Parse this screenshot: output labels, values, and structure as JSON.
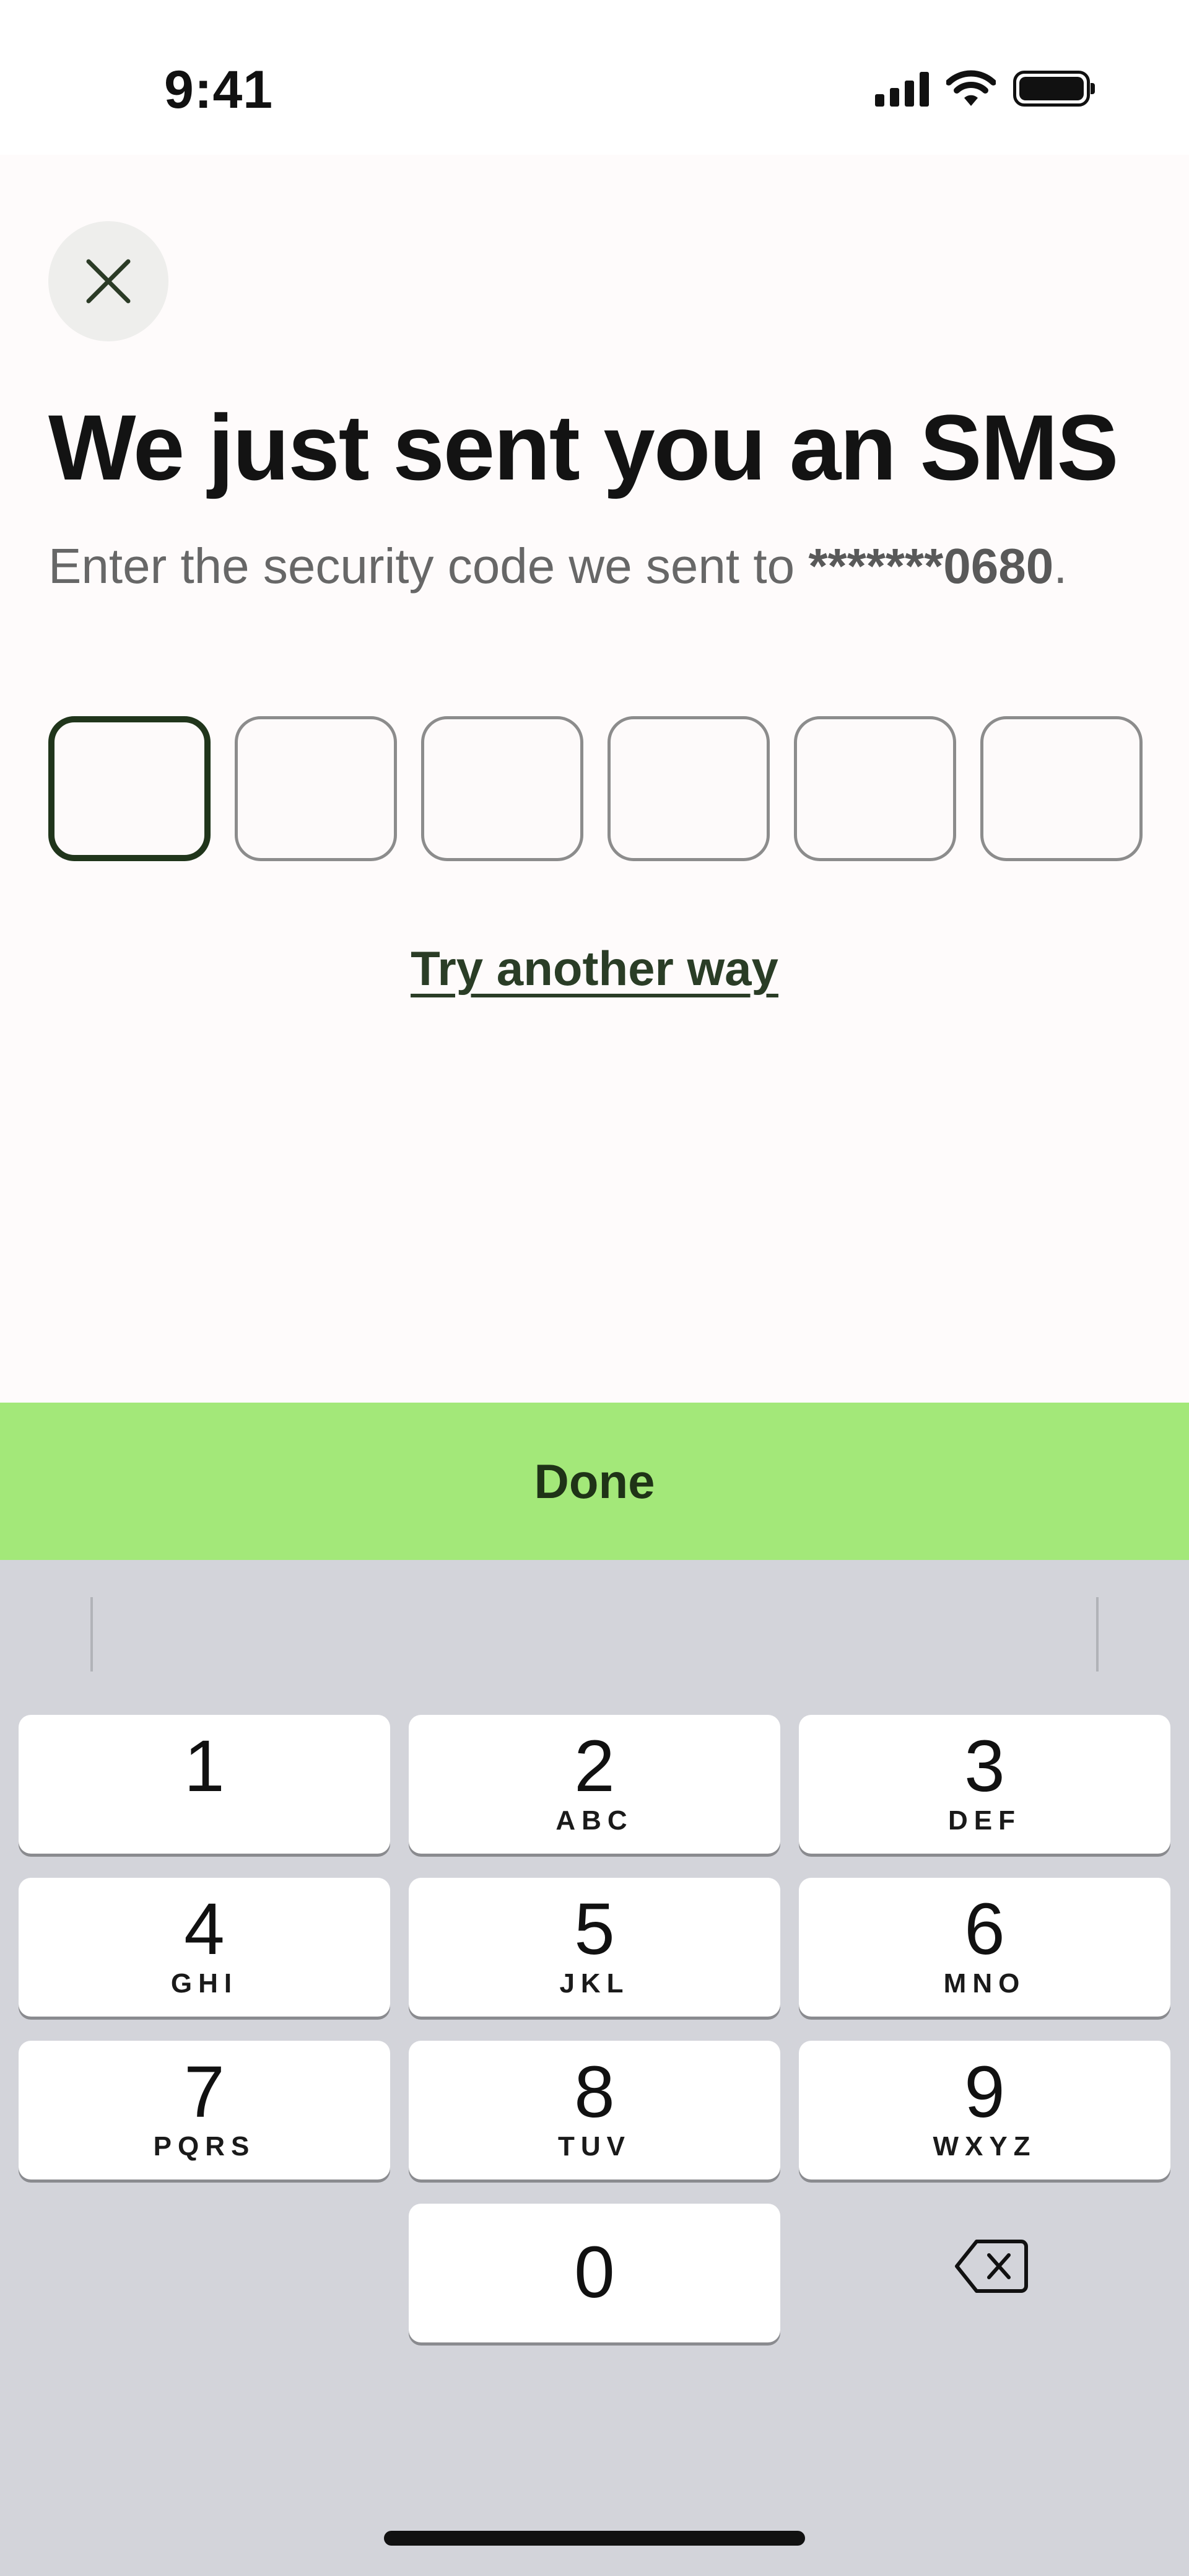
{
  "status": {
    "time": "9:41"
  },
  "header": {
    "title": "We just sent you an SMS",
    "subtitle_prefix": "Enter the security code we sent to ",
    "masked_number": "*******0680",
    "subtitle_suffix": "."
  },
  "code": {
    "length": 6,
    "values": [
      "",
      "",
      "",
      "",
      "",
      ""
    ],
    "active_index": 0
  },
  "links": {
    "try_another": "Try another way"
  },
  "actions": {
    "done_label": "Done"
  },
  "keypad": {
    "keys": [
      {
        "digit": "1",
        "letters": ""
      },
      {
        "digit": "2",
        "letters": "ABC"
      },
      {
        "digit": "3",
        "letters": "DEF"
      },
      {
        "digit": "4",
        "letters": "GHI"
      },
      {
        "digit": "5",
        "letters": "JKL"
      },
      {
        "digit": "6",
        "letters": "MNO"
      },
      {
        "digit": "7",
        "letters": "PQRS"
      },
      {
        "digit": "8",
        "letters": "TUV"
      },
      {
        "digit": "9",
        "letters": "WXYZ"
      },
      {
        "digit": "0",
        "letters": ""
      }
    ],
    "delete_icon": "delete-backspace-icon"
  },
  "colors": {
    "accent": "#a3e879",
    "active_border": "#20351b",
    "link": "#2a3d26",
    "keyboard_bg": "#d3d4da"
  }
}
